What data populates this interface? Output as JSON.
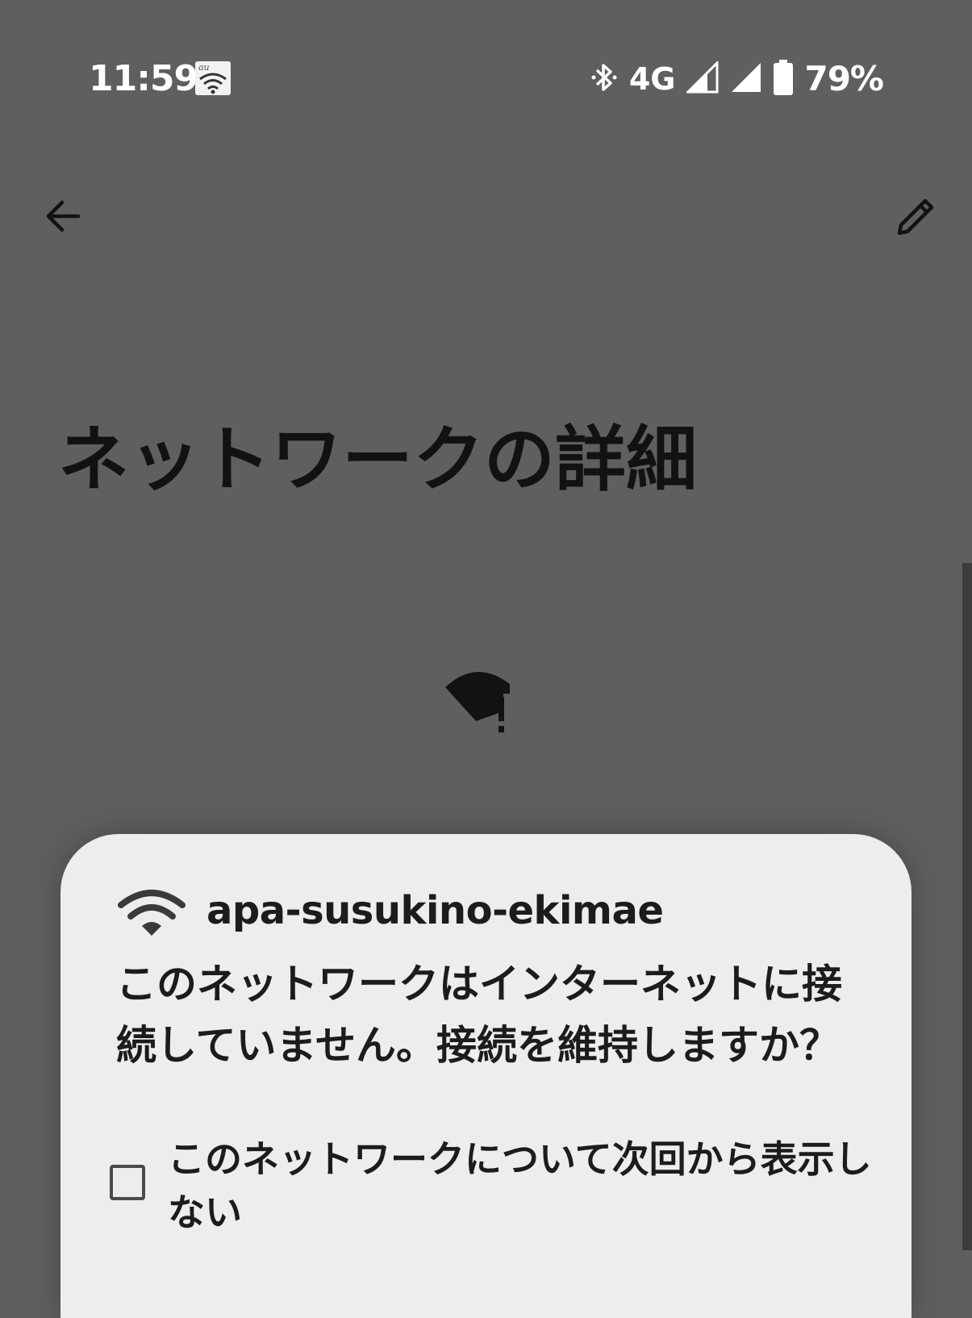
{
  "status_bar": {
    "time": "11:59",
    "carrier_icon": "au-wifi-icon",
    "bluetooth_icon": "bluetooth-icon",
    "network_type": "4G",
    "signal_icons": [
      "signal-strength-icon",
      "signal-strength-icon"
    ],
    "battery_icon": "battery-icon",
    "battery_percent": "79%",
    "colors": {
      "text": "#ffffff"
    }
  },
  "app_bar": {
    "back_icon": "arrow-back-icon",
    "edit_icon": "pencil-icon"
  },
  "page": {
    "title": "ネットワークの詳細",
    "status_icon": "wifi-no-internet-icon"
  },
  "dialog": {
    "wifi_icon": "wifi-icon",
    "ssid": "apa-susukino-ekimae",
    "message": "このネットワークはインターネットに接続していません。接続を維持しますか？",
    "checkbox": {
      "checked": false,
      "label": "このネットワークについて次回から表示しない"
    }
  },
  "colors": {
    "scrim": "#5f5f5f",
    "dialog_background": "#ededed"
  }
}
